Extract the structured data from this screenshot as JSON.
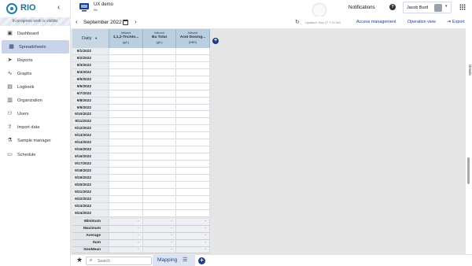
{
  "sidebar": {
    "logo_text": "RIO",
    "collapse_icon": "chevron-left-icon",
    "banner": "In-progress work is visible.",
    "items": [
      {
        "label": "Dashboard",
        "icon": "dashboard-icon",
        "glyph": "▣",
        "active": false
      },
      {
        "label": "Spreadsheets",
        "icon": "spreadsheet-icon",
        "glyph": "▦",
        "active": true
      },
      {
        "label": "Reports",
        "icon": "send-icon",
        "glyph": "➤",
        "active": false
      },
      {
        "label": "Graphs",
        "icon": "line-chart-icon",
        "glyph": "∿",
        "active": false
      },
      {
        "label": "Logbook",
        "icon": "book-icon",
        "glyph": "▤",
        "active": false
      },
      {
        "label": "Organization",
        "icon": "building-icon",
        "glyph": "▥",
        "active": false
      },
      {
        "label": "Users",
        "icon": "users-icon",
        "glyph": "⚇",
        "active": false
      },
      {
        "label": "Import data",
        "icon": "upload-icon",
        "glyph": "⇪",
        "active": false
      },
      {
        "label": "Sample manager",
        "icon": "flask-icon",
        "glyph": "⚗",
        "active": false
      },
      {
        "label": "Schedule",
        "icon": "calendar-icon",
        "glyph": "▭",
        "active": false
      }
    ]
  },
  "topbar": {
    "project_name": "UX demo",
    "project_sub": "Rio",
    "notifications": "Notifications",
    "help_glyph": "?",
    "user_name": "Jacob Burd",
    "user_chevron": "▾"
  },
  "toolbar": {
    "prev_glyph": "‹",
    "month": "September 2022",
    "next_glyph": "›",
    "refresh_glyph": "↻",
    "updated": "Updated: Sep 27 7:22 AM",
    "access_management": "Access management",
    "operation_view": "Operation view",
    "export_glyph": "⇥",
    "export": "Export"
  },
  "grid": {
    "frequency": "Daily",
    "caret": "▾",
    "add_glyph": "+",
    "columns": [
      {
        "label": "Influent",
        "name": "1,1,2-Trichlo...",
        "unit": "(g/L)"
      },
      {
        "label": "Influent",
        "name": "Ba Total",
        "unit": "(g/L)"
      },
      {
        "label": "Influent",
        "name": "Acid Dosing...",
        "unit": "(BBS)"
      }
    ],
    "dates": [
      "9/1/2022",
      "9/2/2022",
      "9/3/2022",
      "9/4/2022",
      "9/5/2022",
      "9/6/2022",
      "9/7/2022",
      "9/8/2022",
      "9/9/2022",
      "9/10/2022",
      "9/11/2022",
      "9/12/2022",
      "9/13/2022",
      "9/14/2022",
      "9/15/2022",
      "9/16/2022",
      "9/17/2022",
      "9/18/2022",
      "9/19/2022",
      "9/20/2022",
      "9/21/2022",
      "9/22/2022",
      "9/23/2022",
      "9/24/2022"
    ],
    "stats": [
      {
        "name": "Minimum",
        "values": [
          "-",
          "-",
          "-"
        ]
      },
      {
        "name": "Maximum",
        "values": [
          "-",
          "-",
          "-"
        ]
      },
      {
        "name": "Average",
        "values": [
          "-",
          "-",
          "-"
        ]
      },
      {
        "name": "Sum",
        "values": [
          "-",
          "-",
          "-"
        ]
      },
      {
        "name": "GeoMean",
        "values": [
          "-",
          "-",
          "-"
        ]
      }
    ]
  },
  "details_label": "Details",
  "bottombar": {
    "star_glyph": "★",
    "search_glyph": "⌕",
    "search_placeholder": "Search",
    "tab_label": "Mapping",
    "tab_menu_glyph": "☰",
    "add_glyph": "+"
  },
  "colors": {
    "brand": "#1e6f95",
    "accent": "#1d3e86",
    "active_nav": "#c9d4ea",
    "column_header": "#b9cfe0"
  }
}
